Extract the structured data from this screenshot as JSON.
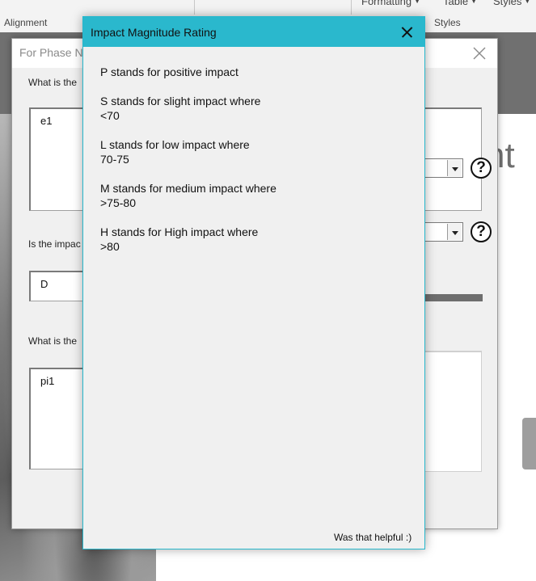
{
  "ribbon": {
    "group_alignment": "Alignment",
    "group_styles": "Styles",
    "menu_formatting": "Formatting",
    "menu_table": "Table",
    "menu_styles": "Styles"
  },
  "sheet": {
    "big_text": "nt"
  },
  "form": {
    "title": "For Phase N",
    "q1_label": "What is the",
    "q1_value": "e1",
    "q2_label": "Is the impac",
    "q2_value": "D",
    "q3_label": "What is the",
    "q3_value": "pi1",
    "help_glyph": "?"
  },
  "dialog": {
    "title": "Impact Magnitude Rating",
    "ratings": [
      {
        "line1": "P stands for positive impact",
        "line2": ""
      },
      {
        "line1": "S stands for slight impact where",
        "line2": "<70"
      },
      {
        "line1": "L stands for low impact where",
        "line2": "70-75"
      },
      {
        "line1": "M stands for medium impact where",
        "line2": ">75-80"
      },
      {
        "line1": "H stands for High impact where",
        "line2": ">80"
      }
    ],
    "footer": "Was that helpful :)"
  }
}
